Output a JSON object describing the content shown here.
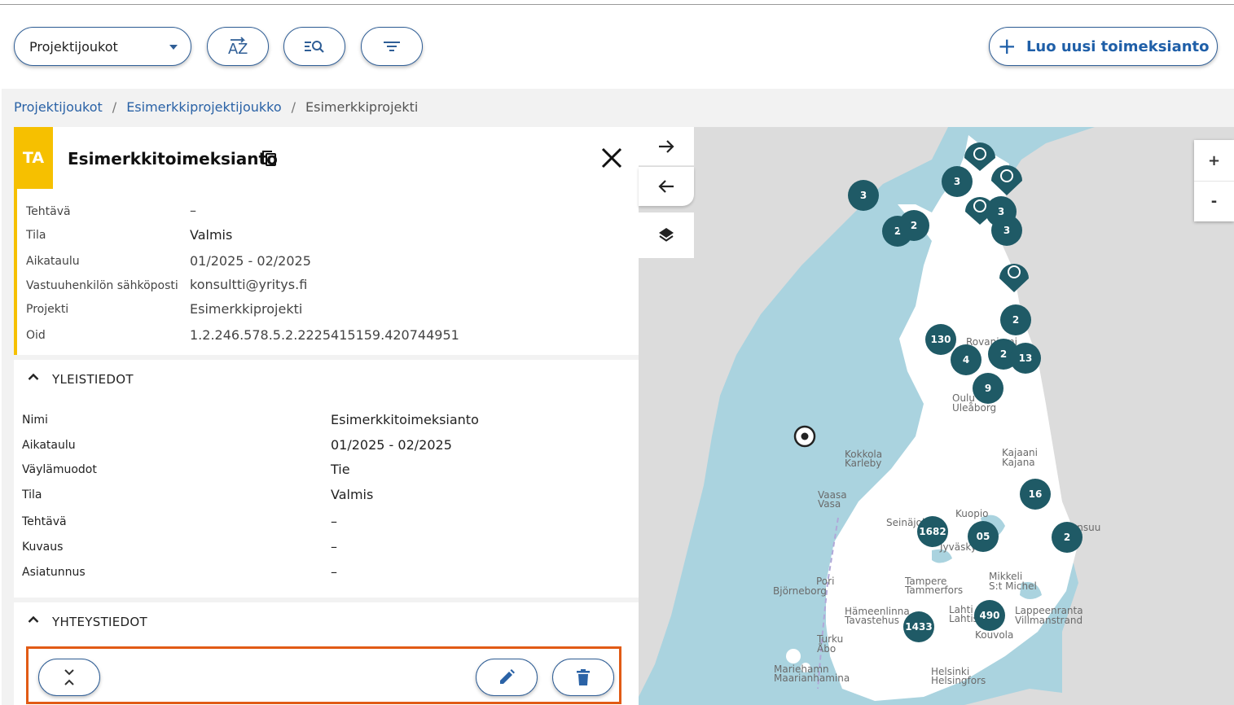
{
  "toolbar": {
    "select_value": "Projektijoukot",
    "create_label": "Luo uusi toimeksianto"
  },
  "breadcrumb": {
    "items": [
      "Projektijoukot",
      "Esimerkkiprojektijoukko"
    ],
    "current": "Esimerkkiprojekti",
    "separator": "/"
  },
  "panel": {
    "badge": "TA",
    "title": "Esimerkkitoimeksianto",
    "summary": [
      {
        "label": "Tehtävä",
        "value": "–"
      },
      {
        "label": "Tila",
        "value": "Valmis"
      },
      {
        "label": "Aikataulu",
        "value": "01/2025 - 02/2025"
      },
      {
        "label": "Vastuuhenkilön sähköposti",
        "value": "konsultti@yritys.fi"
      },
      {
        "label": "Projekti",
        "value": "Esimerkkiprojekti"
      },
      {
        "label": "Oid",
        "value": "1.2.246.578.5.2.2225415159.420744951"
      }
    ],
    "sections": {
      "general": "YLEISTIEDOT",
      "contact": "YHTEYSTIEDOT"
    },
    "details": [
      {
        "label": "Nimi",
        "value": "Esimerkkitoimeksianto"
      },
      {
        "label": "Aikataulu",
        "value": "01/2025 - 02/2025"
      },
      {
        "label": "Väylämuodot",
        "value": "Tie"
      },
      {
        "label": "Tila",
        "value": "Valmis"
      },
      {
        "label": "Tehtävä",
        "value": "–"
      },
      {
        "label": "Kuvaus",
        "value": "–"
      },
      {
        "label": "Asiatunnus",
        "value": "–"
      }
    ]
  },
  "map": {
    "zoom_in": "+",
    "zoom_out": "-",
    "clusters": [
      "3",
      "3",
      "3",
      "3",
      "2",
      "2",
      "2",
      "130",
      "4",
      "2",
      "13",
      "9",
      "16",
      "1682",
      "05",
      "2",
      "490",
      "1433"
    ],
    "places": [
      "Rovaniemi",
      "Oulu",
      "Uleåborg",
      "Kajaani",
      "Kajana",
      "Kokkola",
      "Karleby",
      "Vaasa",
      "Vasa",
      "Seinäjoki",
      "Kuopio",
      "Jyväskylä",
      "Mikkeli",
      "S:t Michel",
      "Pori",
      "Björneborg",
      "Tampere",
      "Tammerfors",
      "Hämeenlinna",
      "Tavastehus",
      "Lahti",
      "Lahtis",
      "Lappeenranta",
      "Villmanstrand",
      "Kouvola",
      "Turku",
      "Åbo",
      "Mariehamn",
      "Maarianhamina",
      "Helsinki",
      "Helsingfors",
      "Joensuu"
    ]
  },
  "colors": {
    "accent": "#2f5e96",
    "badge": "#f6c000",
    "cluster": "#1f5a66",
    "highlight": "#e15b15"
  },
  "icons": [
    "sort-az-icon",
    "search-list-icon",
    "filter-icon",
    "copy-icon",
    "close-icon",
    "arrow-right-icon",
    "arrow-left-icon",
    "layers-icon",
    "collapse-all-icon",
    "edit-icon",
    "delete-icon",
    "locate-icon",
    "chevron-up-icon"
  ]
}
